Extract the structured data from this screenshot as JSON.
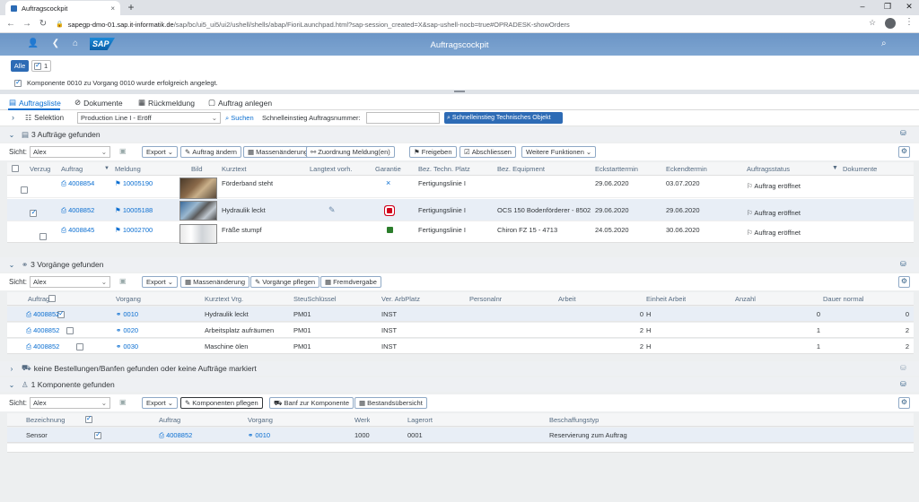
{
  "browser": {
    "tab_title": "Auftragscockpit",
    "url_host": "sapegp-dmo-01.sap.it-informatik.de",
    "url_path": "/sap/bc/ui5_ui5/ui2/ushell/shells/abap/FioriLaunchpad.html?sap-session_created=X&sap-ushell-nocb=true#OPRADESK-showOrders",
    "new_tab": "+",
    "close_tab": "×",
    "minimize": "–",
    "restore": "❐",
    "close": "✕"
  },
  "shell": {
    "title": "Auftragscockpit",
    "logo": "SAP"
  },
  "filter": {
    "all_label": "Alle",
    "count": "1"
  },
  "message": "Komponente 0010 zu Vorgang 0010 wurde erfolgreich angelegt.",
  "app_tabs": [
    "Auftragsliste",
    "Dokumente",
    "Rückmeldung",
    "Auftrag anlegen"
  ],
  "selection": {
    "label": "Selektion",
    "variant": "Production Line I - Eröff",
    "search_label": "Suchen",
    "quick_label": "Schnelleinstieg Auftragsnummer:",
    "quick_value": "",
    "tech_button": "Schnelleinstieg Technisches Objekt"
  },
  "orders": {
    "header": "3 Aufträge gefunden",
    "view_label": "Sicht:",
    "view_value": "Alex",
    "toolbar": [
      "Export",
      "Auftrag ändern",
      "Massenänderung",
      "Zuordnung Meldung(en)",
      "Freigeben",
      "Abschliessen",
      "Weitere Funktionen"
    ],
    "columns": [
      "Verzug",
      "Auftrag",
      "Meldung",
      "Bild",
      "Kurztext",
      "Langtext vorh.",
      "Garantie",
      "Bez. Techn. Platz",
      "Bez. Equipment",
      "Eckstarttermin",
      "Eckendtermin",
      "Auftragsstatus",
      "Dokumente"
    ],
    "rows": [
      {
        "auftrag": "4008854",
        "meldung": "10005190",
        "kurztext": "Förderband steht",
        "garantie": "×",
        "platz": "Fertigungslinie I",
        "equipment": "",
        "start": "29.06.2020",
        "ende": "03.07.2020",
        "status": "Auftrag eröffnet",
        "selected": false
      },
      {
        "auftrag": "4008852",
        "meldung": "10005188",
        "kurztext": "Hydraulik leckt",
        "garantie": "red",
        "platz": "Fertigungslinie I",
        "equipment": "OCS 150 Bodenförderer - 8502",
        "start": "29.06.2020",
        "ende": "29.06.2020",
        "status": "Auftrag eröffnet",
        "selected": true
      },
      {
        "auftrag": "4008845",
        "meldung": "10002700",
        "kurztext": "Fräße stumpf",
        "garantie": "green",
        "platz": "Fertigungslinie I",
        "equipment": "Chiron FZ 15 - 4713",
        "start": "24.05.2020",
        "ende": "30.06.2020",
        "status": "Auftrag eröffnet",
        "selected": false
      }
    ]
  },
  "ops": {
    "header": "3 Vorgänge gefunden",
    "view_label": "Sicht:",
    "view_value": "Alex",
    "toolbar": [
      "Export",
      "Massenänderung",
      "Vorgänge pflegen",
      "Fremdvergabe"
    ],
    "columns": [
      "Auftrag",
      "Vorgang",
      "Kurztext Vrg.",
      "SteuSchlüssel",
      "Ver. ArbPlatz",
      "Personalnr",
      "Arbeit",
      "Einheit Arbeit",
      "Anzahl",
      "Dauer normal"
    ],
    "rows": [
      {
        "auftrag": "4008852",
        "vorgang": "0010",
        "kurztext": "Hydraulik leckt",
        "steu": "PM01",
        "arbplatz": "INST",
        "personal": "",
        "arbeit": "0",
        "einheit": "H",
        "anzahl": "0",
        "dauer": "0",
        "selected": true
      },
      {
        "auftrag": "4008852",
        "vorgang": "0020",
        "kurztext": "Arbeitsplatz aufräumen",
        "steu": "PM01",
        "arbplatz": "INST",
        "personal": "",
        "arbeit": "2",
        "einheit": "H",
        "anzahl": "1",
        "dauer": "2",
        "selected": false
      },
      {
        "auftrag": "4008852",
        "vorgang": "0030",
        "kurztext": "Maschine ölen",
        "steu": "PM01",
        "arbplatz": "INST",
        "personal": "",
        "arbeit": "2",
        "einheit": "H",
        "anzahl": "1",
        "dauer": "2",
        "selected": false
      }
    ]
  },
  "purchase": {
    "header": "keine Bestellungen/Banfen gefunden oder keine Aufträge markiert"
  },
  "components": {
    "header": "1 Komponente gefunden",
    "view_label": "Sicht:",
    "view_value": "Alex",
    "toolbar": [
      "Export",
      "Komponenten pflegen",
      "Banf zur Komponente",
      "Bestandsübersicht"
    ],
    "columns": [
      "Bezeichnung",
      "Auftrag",
      "Vorgang",
      "Werk",
      "Lagerort",
      "Beschaffungstyp"
    ],
    "rows": [
      {
        "bezeichnung": "Sensor",
        "auftrag": "4008852",
        "vorgang": "0010",
        "werk": "1000",
        "lagerort": "0001",
        "typ": "Reservierung zum Auftrag",
        "selected": true
      }
    ]
  },
  "colors": {
    "shell": "#7ea5d1",
    "accent": "#0a6ed1",
    "selected_row": "#e8eef6"
  }
}
